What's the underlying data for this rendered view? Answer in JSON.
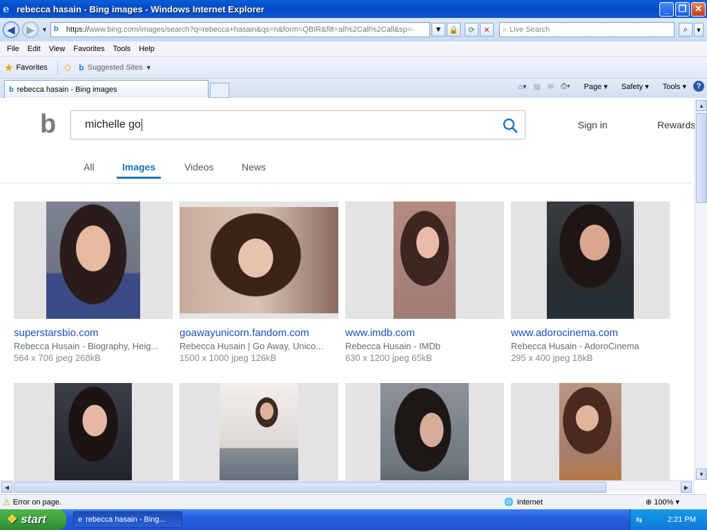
{
  "window": {
    "title": "rebecca hasain - Bing images - Windows Internet Explorer",
    "icon": "ie-icon"
  },
  "address": {
    "scheme": "https://",
    "host": "www.bing.com",
    "path": "/images/search?q=rebecca+hasain&qs=n&form=QBIR&filt=all%2Call%2Call&sp=-",
    "placeholder_search": "Live Search"
  },
  "menu": [
    "File",
    "Edit",
    "View",
    "Favorites",
    "Tools",
    "Help"
  ],
  "favorites": {
    "label": "Favorites",
    "suggested": "Suggested Sites"
  },
  "tab": {
    "label": "rebecca hasain - Bing images"
  },
  "commands": {
    "page": "Page",
    "safety": "Safety",
    "tools": "Tools"
  },
  "bing": {
    "query": "michelle go",
    "signin": "Sign in",
    "rewards": "Rewards",
    "scopes": [
      "All",
      "Images",
      "Videos",
      "News"
    ],
    "active_scope": "Images"
  },
  "results": [
    {
      "site": "superstarsbio.com",
      "desc": "Rebecca Husain - Biography, Heig...",
      "meta": "564 x 706 jpeg 268kB"
    },
    {
      "site": "goawayunicorn.fandom.com",
      "desc": "Rebecca Husain | Go Away, Unico...",
      "meta": "1500 x 1000 jpeg 126kB"
    },
    {
      "site": "www.imdb.com",
      "desc": "Rebecca Husain - IMDb",
      "meta": "630 x 1200 jpeg 65kB"
    },
    {
      "site": "www.adorocinema.com",
      "desc": "Rebecca Husain - AdoroCinema",
      "meta": "295 x 400 jpeg 18kB"
    }
  ],
  "status": {
    "text": "Error on page.",
    "zone": "Internet",
    "zoom": "100%"
  },
  "taskbar": {
    "start": "start",
    "item": "rebecca hasain - Bing...",
    "clock": "2:21 PM"
  }
}
